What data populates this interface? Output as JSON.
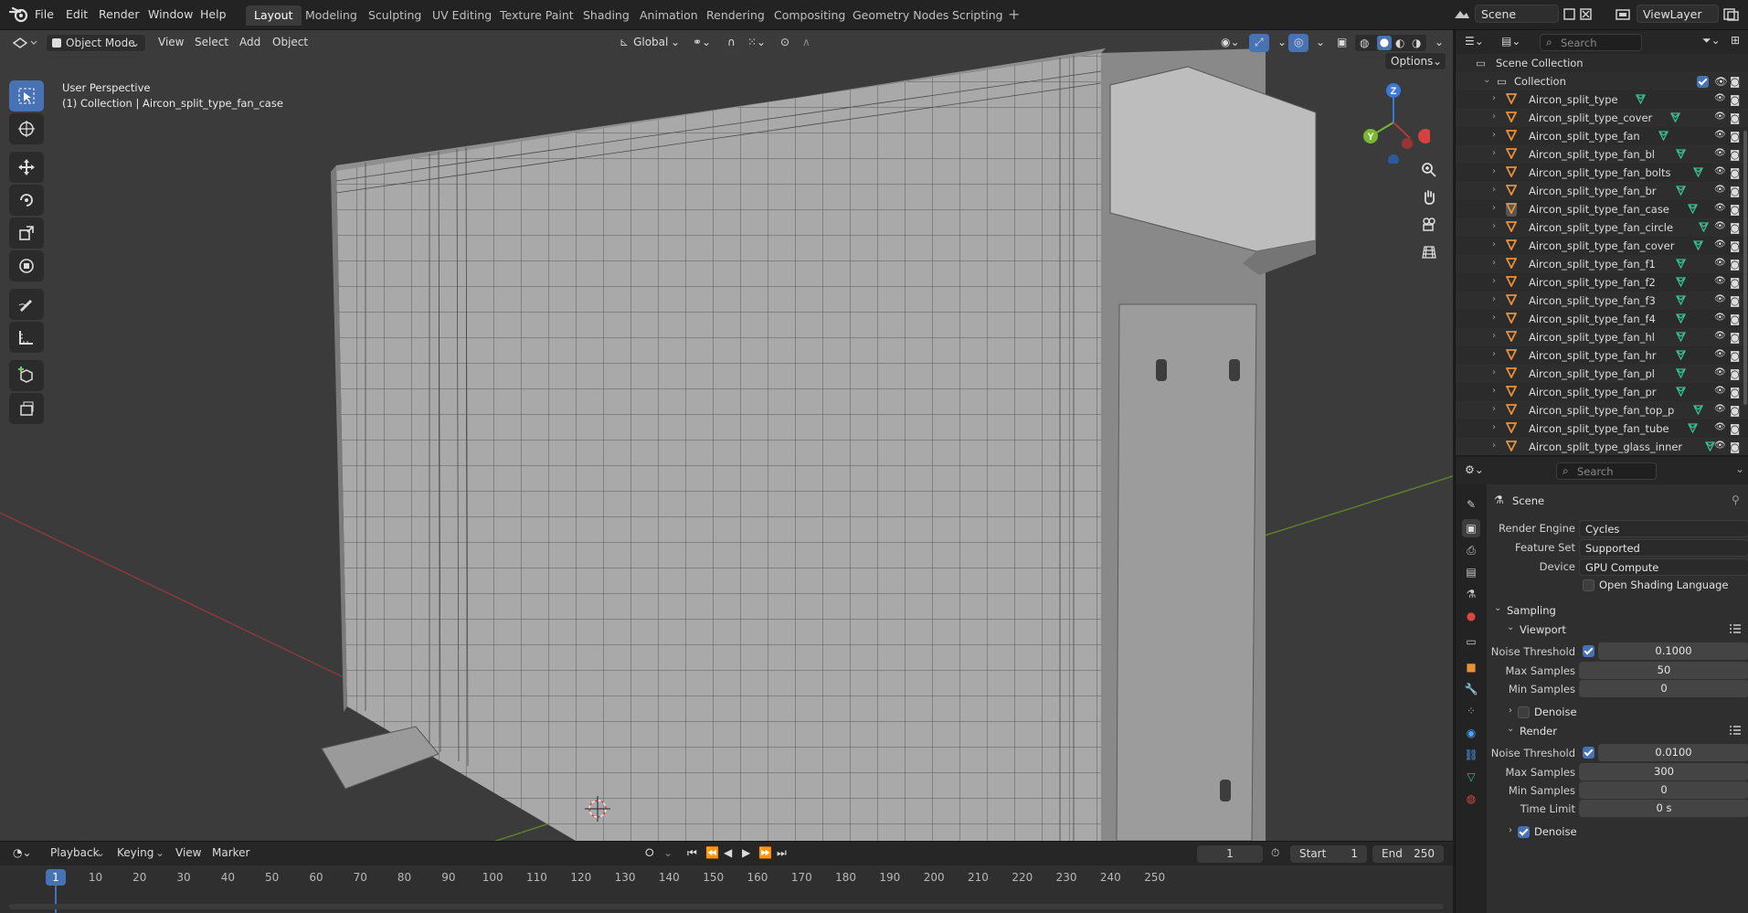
{
  "topbar": {
    "menus": [
      "File",
      "Edit",
      "Render",
      "Window",
      "Help"
    ],
    "workspaces": [
      "Layout",
      "Modeling",
      "Sculpting",
      "UV Editing",
      "Texture Paint",
      "Shading",
      "Animation",
      "Rendering",
      "Compositing",
      "Geometry Nodes",
      "Scripting"
    ],
    "active_workspace": "Layout",
    "scene_name": "Scene",
    "view_layer": "ViewLayer"
  },
  "viewport": {
    "mode": "Object Mode",
    "menus": [
      "View",
      "Select",
      "Add",
      "Object"
    ],
    "orientation": "Global",
    "options_label": "Options",
    "info_line1": "User Perspective",
    "info_line2": "(1) Collection | Aircon_split_type_fan_case",
    "gizmo_axes": {
      "z": "Z",
      "y": "Y"
    }
  },
  "timeline": {
    "menus": [
      "Playback",
      "Keying",
      "View",
      "Marker"
    ],
    "current_frame": "1",
    "start_label": "Start",
    "start_value": "1",
    "end_label": "End",
    "end_value": "250",
    "ticks": [
      "10",
      "20",
      "30",
      "40",
      "50",
      "60",
      "70",
      "80",
      "90",
      "100",
      "110",
      "120",
      "130",
      "140",
      "150",
      "160",
      "170",
      "180",
      "190",
      "200",
      "210",
      "220",
      "230",
      "240",
      "250"
    ],
    "cursor_label": "1"
  },
  "outliner": {
    "search_placeholder": "Search",
    "root": "Scene Collection",
    "collection": "Collection",
    "items": [
      "Aircon_split_type",
      "Aircon_split_type_cover",
      "Aircon_split_type_fan",
      "Aircon_split_type_fan_bl",
      "Aircon_split_type_fan_bolts",
      "Aircon_split_type_fan_br",
      "Aircon_split_type_fan_case",
      "Aircon_split_type_fan_circle",
      "Aircon_split_type_fan_cover",
      "Aircon_split_type_fan_f1",
      "Aircon_split_type_fan_f2",
      "Aircon_split_type_fan_f3",
      "Aircon_split_type_fan_f4",
      "Aircon_split_type_fan_hl",
      "Aircon_split_type_fan_hr",
      "Aircon_split_type_fan_pl",
      "Aircon_split_type_fan_pr",
      "Aircon_split_type_fan_top_p",
      "Aircon_split_type_fan_tube",
      "Aircon_split_type_glass_inner"
    ],
    "selected_item": "Aircon_split_type_fan_case"
  },
  "properties": {
    "search_placeholder": "Search",
    "context": "Scene",
    "render_engine_label": "Render Engine",
    "render_engine": "Cycles",
    "feature_set_label": "Feature Set",
    "feature_set": "Supported",
    "device_label": "Device",
    "device": "GPU Compute",
    "osl_label": "Open Shading Language",
    "sampling": "Sampling",
    "viewport": {
      "title": "Viewport",
      "noise_threshold_label": "Noise Threshold",
      "noise_threshold": "0.1000",
      "max_samples_label": "Max Samples",
      "max_samples": "50",
      "min_samples_label": "Min Samples",
      "min_samples": "0",
      "denoise_label": "Denoise"
    },
    "render": {
      "title": "Render",
      "noise_threshold_label": "Noise Threshold",
      "noise_threshold": "0.0100",
      "max_samples_label": "Max Samples",
      "max_samples": "300",
      "min_samples_label": "Min Samples",
      "min_samples": "0",
      "time_limit_label": "Time Limit",
      "time_limit": "0 s",
      "denoise_label": "Denoise"
    }
  },
  "colors": {
    "accent": "#4772b3",
    "mesh_icon": "#e8913c",
    "vertex_group": "#39c08f"
  }
}
